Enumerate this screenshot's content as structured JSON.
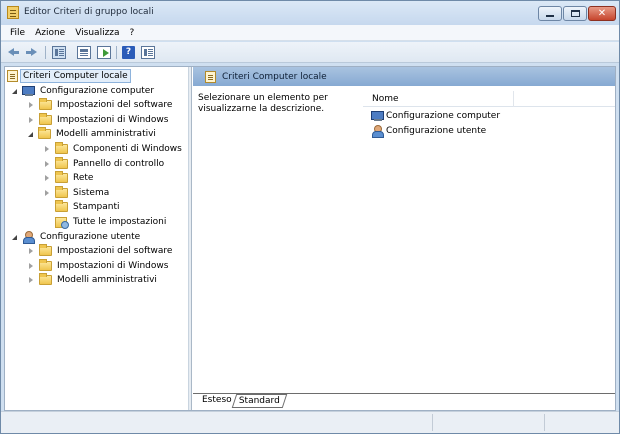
{
  "window": {
    "title": "Editor Criteri di gruppo locali",
    "app_icon": "policy-editor-icon"
  },
  "menu": [
    "File",
    "Azione",
    "Visualizza",
    "?"
  ],
  "toolbar": {
    "buttons": [
      "back-arrow-icon",
      "forward-arrow-icon",
      "show-hide-console-tree-icon",
      "properties-icon",
      "export-list-icon",
      "help-icon",
      "extended-view-icon"
    ]
  },
  "tree": {
    "root": "Criteri Computer locale",
    "computer": {
      "label": "Configurazione computer",
      "children": [
        "Impostazioni del software",
        "Impostazioni di Windows",
        "Modelli amministrativi"
      ],
      "admin_children": [
        "Componenti di Windows",
        "Pannello di controllo",
        "Rete",
        "Sistema",
        "Stampanti",
        "Tutte le impostazioni"
      ]
    },
    "user": {
      "label": "Configurazione utente",
      "children": [
        "Impostazioni del software",
        "Impostazioni di Windows",
        "Modelli amministrativi"
      ]
    }
  },
  "right_pane": {
    "header": "Criteri Computer locale",
    "description": "Selezionare un elemento per visualizzarne la descrizione.",
    "column_header": "Nome",
    "items": [
      "Configurazione computer",
      "Configurazione utente"
    ]
  },
  "tabs": [
    "Esteso",
    "Standard"
  ],
  "colors": {
    "title_bar": "#cfdff0",
    "header_band": "#86a9d2",
    "close_button": "#c6452d",
    "selection": "#e3eefa"
  }
}
